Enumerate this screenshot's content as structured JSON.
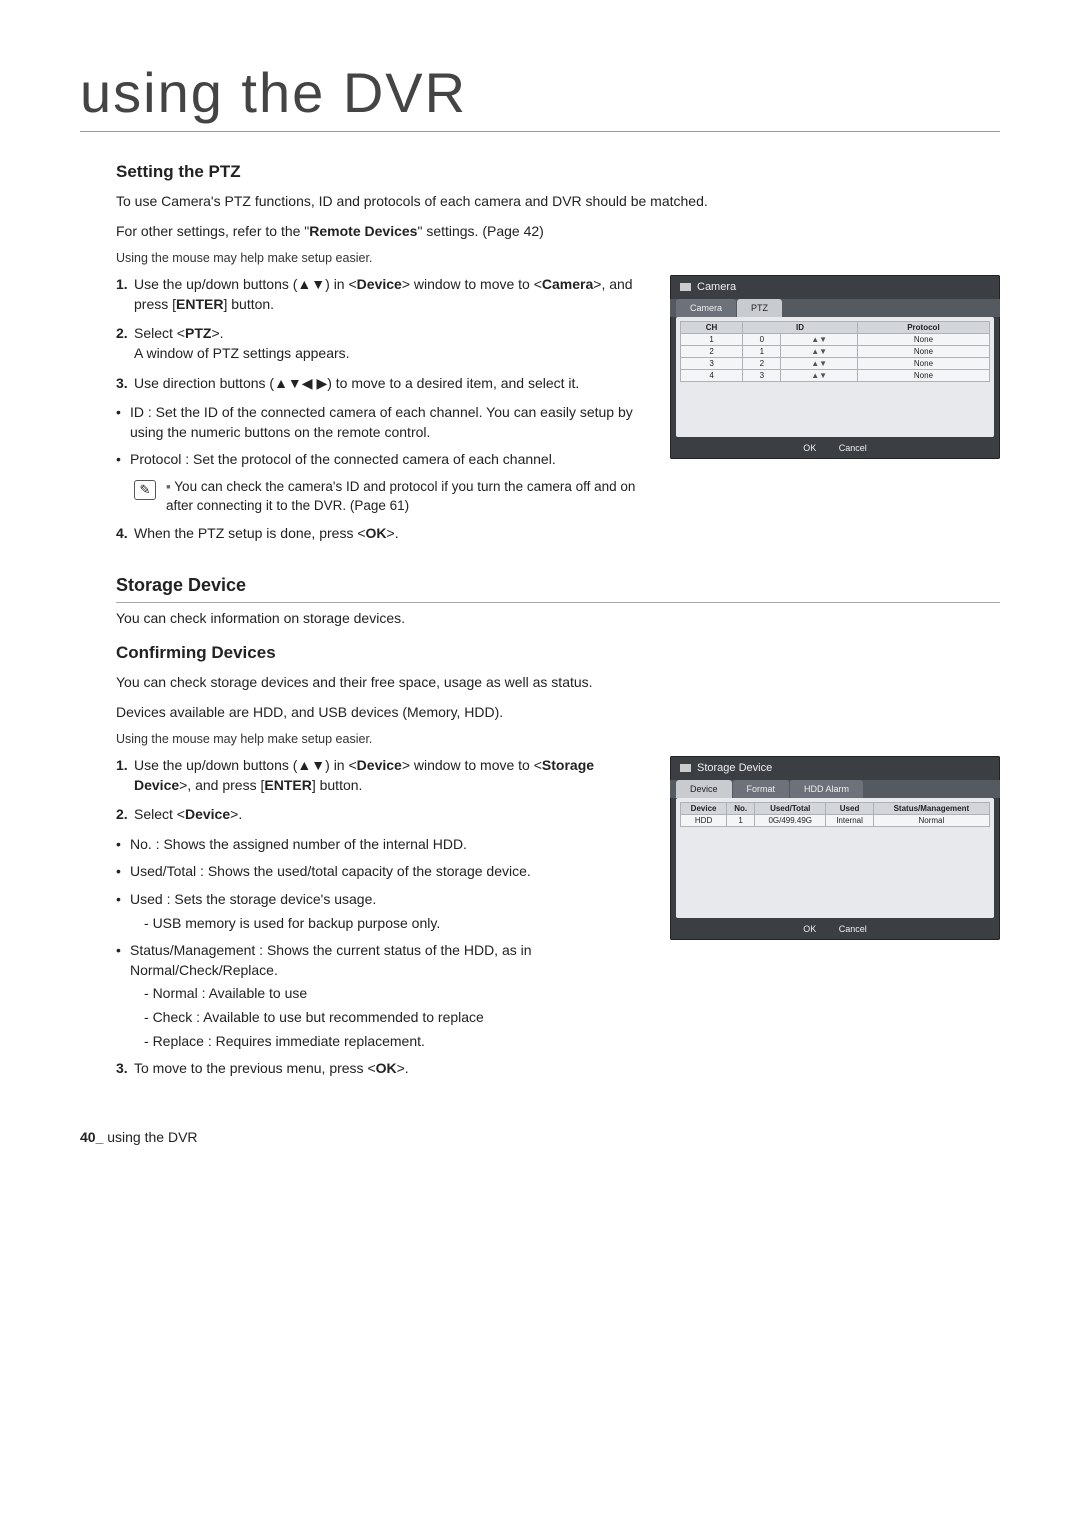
{
  "chapter": "using the DVR",
  "ptz": {
    "heading": "Setting the PTZ",
    "intro1": "To use Camera's PTZ functions, ID and protocols of each camera and DVR should be matched.",
    "intro2_a": "For other settings, refer to the \"",
    "intro2_b": "Remote Devices",
    "intro2_c": "\" settings. (Page 42)",
    "mouse_note": "Using the mouse may help make setup easier.",
    "step1_a": "Use the up/down buttons (▲▼) in <",
    "step1_b": "Device",
    "step1_c": "> window to move to <",
    "step1_d": "Camera",
    "step1_e": ">, and press [",
    "step1_f": "ENTER",
    "step1_g": "] button.",
    "step2_a": "Select <",
    "step2_b": "PTZ",
    "step2_c": ">.",
    "step2_d": "A window of PTZ settings appears.",
    "step3": "Use direction buttons (▲▼◀ ▶) to move to a desired item, and select it.",
    "bul_id": "ID : Set the ID of the connected camera of each channel. You can easily setup by using the numeric buttons on the remote control.",
    "bul_proto": "Protocol : Set the protocol of the connected camera of each channel.",
    "note": "You can check the camera's ID and protocol if you turn the camera off and on after connecting it to the DVR. (Page 61)",
    "step4_a": "When the PTZ setup is done, press <",
    "step4_b": "OK",
    "step4_c": ">."
  },
  "storage": {
    "heading": "Storage Device",
    "intro": "You can check information on storage devices."
  },
  "confirm": {
    "heading": "Confirming Devices",
    "intro1": "You can check storage devices and their free space, usage as well as status.",
    "intro2": "Devices available are HDD, and USB devices (Memory, HDD).",
    "mouse_note": "Using the mouse may help make setup easier.",
    "step1_a": "Use the up/down buttons (▲▼) in <",
    "step1_b": "Device",
    "step1_c": "> window to move to <",
    "step1_d": "Storage Device",
    "step1_e": ">, and press [",
    "step1_f": "ENTER",
    "step1_g": "] button.",
    "step2_a": "Select <",
    "step2_b": "Device",
    "step2_c": ">.",
    "bul_no": "No. : Shows the assigned number of the internal HDD.",
    "bul_used_total": "Used/Total : Shows the used/total capacity of the storage device.",
    "bul_used": "Used : Sets the storage device's usage.",
    "bul_used_sub": "USB memory is used for backup purpose only.",
    "bul_status": "Status/Management : Shows the current status of the HDD, as in Normal/Check/Replace.",
    "sub_normal": "Normal : Available to use",
    "sub_check": "Check : Available to use but recommended to replace",
    "sub_replace": "Replace : Requires immediate replacement.",
    "step3_a": "To move to the previous menu, press <",
    "step3_b": "OK",
    "step3_c": ">."
  },
  "panel_camera": {
    "title": "Camera",
    "tab1": "Camera",
    "tab2": "PTZ",
    "th_ch": "CH",
    "th_id": "ID",
    "th_proto": "Protocol",
    "rows": [
      {
        "ch": "1",
        "id": "0",
        "proto": "None"
      },
      {
        "ch": "2",
        "id": "1",
        "proto": "None"
      },
      {
        "ch": "3",
        "id": "2",
        "proto": "None"
      },
      {
        "ch": "4",
        "id": "3",
        "proto": "None"
      }
    ],
    "ok": "OK",
    "cancel": "Cancel"
  },
  "panel_storage": {
    "title": "Storage Device",
    "tab1": "Device",
    "tab2": "Format",
    "tab3": "HDD Alarm",
    "th_dev": "Device",
    "th_no": "No.",
    "th_ut": "Used/Total",
    "th_used": "Used",
    "th_sm": "Status/Management",
    "row": {
      "dev": "HDD",
      "no": "1",
      "ut": "0G/499.49G",
      "used": "Internal",
      "sm": "Normal"
    },
    "ok": "OK",
    "cancel": "Cancel"
  },
  "footer": {
    "pg": "40_",
    "txt": " using the DVR"
  },
  "icon": {
    "note": "✎"
  }
}
